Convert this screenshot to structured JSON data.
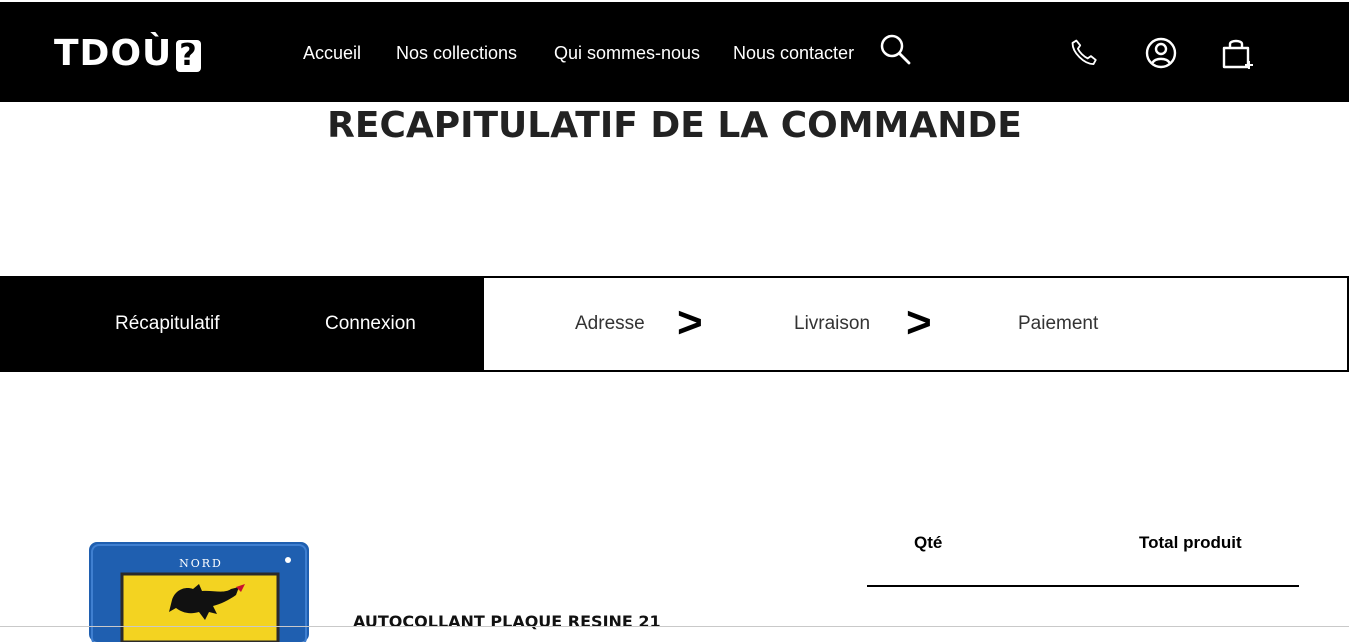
{
  "header": {
    "logo_text": "TDOÙ",
    "logo_mark": "?",
    "nav": [
      "Accueil",
      "Nos collections",
      "Qui sommes-nous",
      "Nous contacter"
    ],
    "icons": [
      "search-icon",
      "phone-icon",
      "account-icon",
      "cart-icon"
    ]
  },
  "page": {
    "title": "RECAPITULATIF DE LA COMMANDE"
  },
  "steps": {
    "items": [
      "Récapitulatif",
      "Connexion",
      "Adresse",
      "Livraison",
      "Paiement"
    ],
    "separator": ">",
    "completed_count": 2
  },
  "cart": {
    "columns": {
      "qty": "Qté",
      "total": "Total produit"
    },
    "items": [
      {
        "badge": "NORD",
        "name": "AUTOCOLLANT PLAQUE RESINE 21"
      }
    ]
  },
  "colors": {
    "header_bg": "#000000",
    "accent_blue": "#1f5fb0",
    "shield_yellow": "#f3d321"
  }
}
